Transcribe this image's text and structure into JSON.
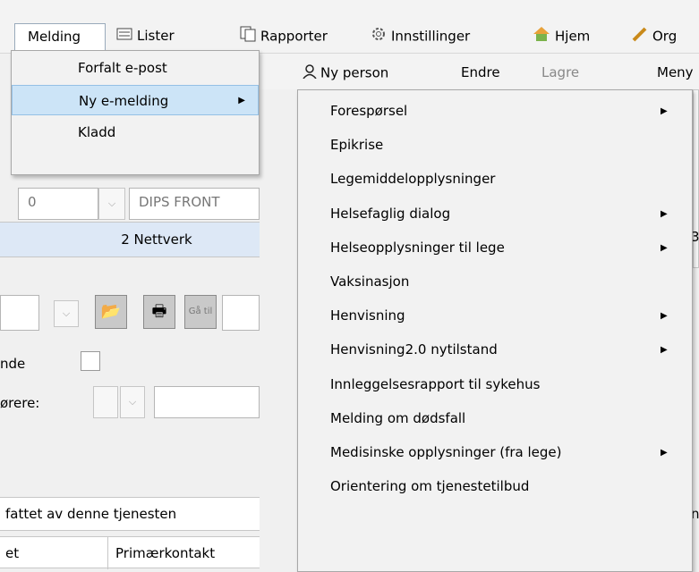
{
  "menubar": {
    "melding": "Melding",
    "lister": "Lister",
    "rapporter": "Rapporter",
    "innstillinger": "Innstillinger",
    "hjem": "Hjem",
    "org": "Org"
  },
  "toolbar": {
    "ny_person": "Ny person",
    "endre": "Endre",
    "lagre": "Lagre",
    "meny": "Meny"
  },
  "melding_menu": [
    {
      "label": "Forfalt e-post",
      "has_submenu": false,
      "selected": false
    },
    {
      "label": "Ny e-melding",
      "has_submenu": true,
      "selected": true
    },
    {
      "label": "Kladd",
      "has_submenu": false,
      "selected": false
    }
  ],
  "ny_emelding_menu": [
    {
      "label": "Forespørsel",
      "has_submenu": true
    },
    {
      "label": "Epikrise",
      "has_submenu": false
    },
    {
      "label": "Legemiddelopplysninger",
      "has_submenu": false
    },
    {
      "label": "Helsefaglig dialog",
      "has_submenu": true
    },
    {
      "label": "Helseopplysninger til lege",
      "has_submenu": true
    },
    {
      "label": "Vaksinasjon",
      "has_submenu": false
    },
    {
      "label": "Henvisning",
      "has_submenu": true
    },
    {
      "label": "Henvisning2.0 nytilstand",
      "has_submenu": true
    },
    {
      "label": "Innleggelsesrapport til sykehus",
      "has_submenu": false
    },
    {
      "label": "Melding om dødsfall",
      "has_submenu": false
    },
    {
      "label": "Medisinske opplysninger (fra lege)",
      "has_submenu": true
    },
    {
      "label": "Orientering om tjenestetilbud",
      "has_submenu": false
    }
  ],
  "background": {
    "combo_value": "0",
    "dips_front": "DIPS FRONT",
    "nettverk_tab": "2 Nettverk",
    "ga_til": "Gå til",
    "label_nde": "nde",
    "label_orere": "ørere:",
    "fattet": "fattet av denne tjenesten",
    "col_et": "et",
    "col_primaerkontakt": "Primærkontakt",
    "right_3": "3",
    "right_n": "n"
  },
  "colors": {
    "menu_bg": "#f2f2f2",
    "selected_bg": "#cce4f7",
    "tab_bg": "#dde8f6"
  }
}
